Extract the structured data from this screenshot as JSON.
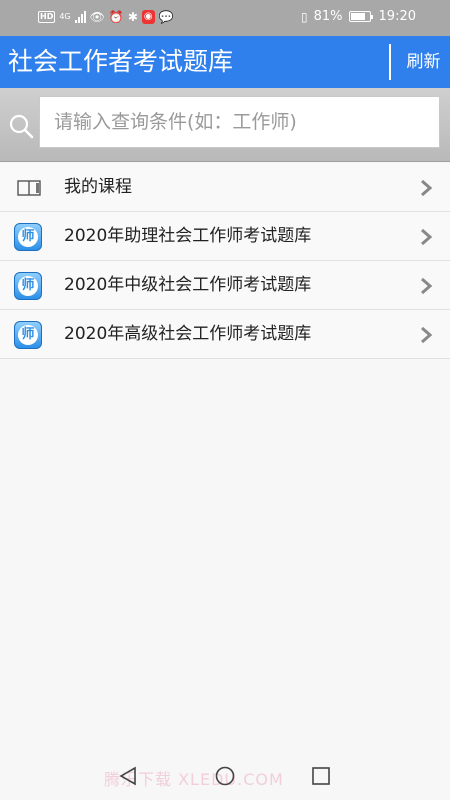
{
  "status": {
    "badge_hd": "HD",
    "net": "4G",
    "battery_percent": "81%",
    "battery_level": 0.81,
    "time": "19:20"
  },
  "header": {
    "title": "社会工作者考试题库",
    "refresh_label": "刷新"
  },
  "search": {
    "placeholder": "请输入查询条件(如：工作师)",
    "value": ""
  },
  "list": [
    {
      "label": "我的课程",
      "icon": "book-icon"
    },
    {
      "label": "2020年助理社会工作师考试题库",
      "icon": "app-icon",
      "icon_text": "师"
    },
    {
      "label": "2020年中级社会工作师考试题库",
      "icon": "app-icon",
      "icon_text": "师"
    },
    {
      "label": "2020年高级社会工作师考试题库",
      "icon": "app-icon",
      "icon_text": "师"
    }
  ],
  "watermark": "腾乐下载 XLEDU.COM",
  "colors": {
    "accent": "#2f80ed",
    "statusbar": "#a8a8a8"
  }
}
